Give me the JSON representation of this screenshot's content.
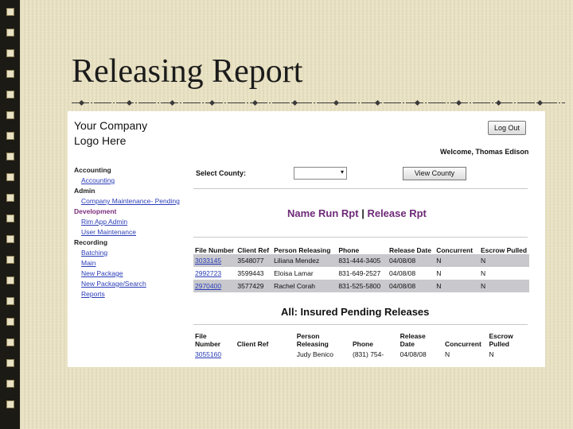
{
  "slide": {
    "title": "Releasing Report"
  },
  "app": {
    "logo_line1": "Your Company",
    "logo_line2": "Logo Here",
    "logout_label": "Log Out",
    "welcome": "Welcome, Thomas Edison",
    "nav": {
      "accounting": {
        "label": "Accounting",
        "items": [
          "Accounting"
        ]
      },
      "admin": {
        "label": "Admin",
        "items": [
          "Company Maintenance- Pending"
        ]
      },
      "development": {
        "label": "Development",
        "items": [
          "Rim App Admin",
          "User Maintenance"
        ]
      },
      "recording": {
        "label": "Recording",
        "items": [
          "Batching",
          "Main",
          "New Package",
          "New Package/Search",
          "Reports"
        ]
      }
    },
    "county_label": "Select County:",
    "county_value": "",
    "view_county_label": "View County",
    "report_links": {
      "name_run": "Name Run Rpt",
      "separator": "|",
      "release": "Release Rpt"
    },
    "release_table": {
      "headers": [
        "File Number",
        "Client Ref",
        "Person Releasing",
        "Phone",
        "Release Date",
        "Concurrent",
        "Escrow Pulled"
      ],
      "rows": [
        [
          "3033145",
          "3548077",
          "Liliana Mendez",
          "831-444-3405",
          "04/08/08",
          "N",
          "N"
        ],
        [
          "2992723",
          "3599443",
          "Eloisa Lamar",
          "831-649-2527",
          "04/08/08",
          "N",
          "N"
        ],
        [
          "2970400",
          "3577429",
          "Rachel Corah",
          "831-525-5800",
          "04/08/08",
          "N",
          "N"
        ]
      ]
    },
    "pending_title": "All: Insured Pending Releases",
    "pending_table": {
      "headers": [
        "File Number",
        "Client Ref",
        "Person Releasing",
        "Phone",
        "Release Date",
        "Concurrent",
        "Escrow Pulled"
      ],
      "rows": [
        [
          "3055160",
          "",
          "Judy Benico",
          "(831) 754-",
          "04/08/08",
          "N",
          "N"
        ]
      ]
    }
  }
}
